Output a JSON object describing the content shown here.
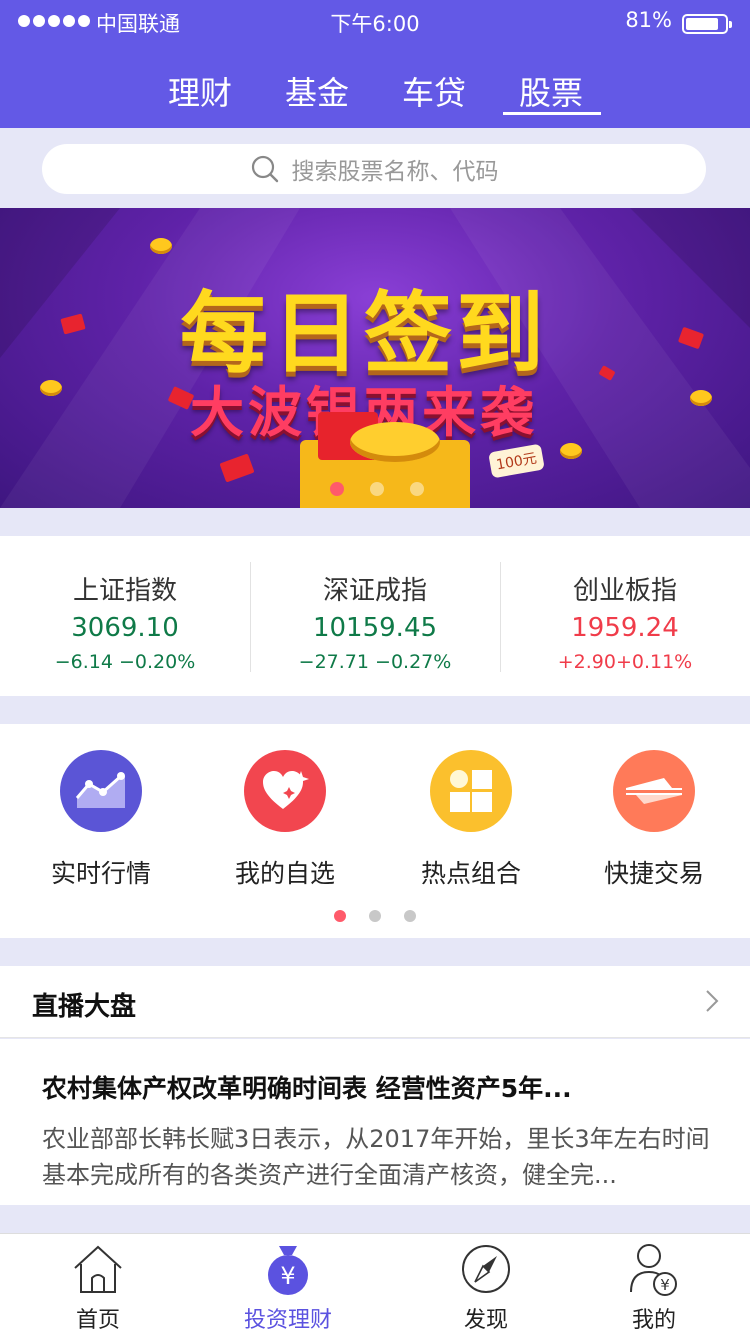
{
  "status_bar": {
    "carrier": "中国联通",
    "time": "下午6:00",
    "battery": "81%"
  },
  "tabs": [
    {
      "label": "理财"
    },
    {
      "label": "基金"
    },
    {
      "label": "车贷"
    },
    {
      "label": "股票",
      "active": true
    }
  ],
  "search": {
    "placeholder": "搜索股票名称、代码"
  },
  "banner": {
    "title": "每日签到",
    "subtitle": "大波银两来袭",
    "badge": "100元"
  },
  "indices": [
    {
      "name": "上证指数",
      "value": "3069.10",
      "change": "−6.14 −0.20%",
      "trend": "down"
    },
    {
      "name": "深证成指",
      "value": "10159.45",
      "change": "−27.71 −0.27%",
      "trend": "down"
    },
    {
      "name": "创业板指",
      "value": "1959.24",
      "change": "+2.90+0.11%",
      "trend": "up"
    }
  ],
  "shortcuts": [
    {
      "label": "实时行情",
      "icon": "line-chart-icon",
      "color": "#5b55d6"
    },
    {
      "label": "我的自选",
      "icon": "heart-icon",
      "color": "#f2464f"
    },
    {
      "label": "热点组合",
      "icon": "grid-icon",
      "color": "#fbc02d"
    },
    {
      "label": "快捷交易",
      "icon": "transfer-icon",
      "color": "#ff7a59"
    }
  ],
  "live": {
    "title": "直播大盘",
    "article": {
      "headline": "农村集体产权改革明确时间表 经营性资产5年...",
      "body": "农业部部长韩长赋3日表示，从2017年开始，里长3年左右时间基本完成所有的各类资产进行全面清产核资，健全完..."
    }
  },
  "tabbar": [
    {
      "label": "首页",
      "icon": "home-icon"
    },
    {
      "label": "投资理财",
      "icon": "yuan-bag-icon",
      "active": true
    },
    {
      "label": "发现",
      "icon": "compass-icon"
    },
    {
      "label": "我的",
      "icon": "user-yuan-icon"
    }
  ],
  "colors": {
    "brand": "#6359e6",
    "down": "#0f7a48",
    "up": "#f03c4a",
    "accent_dot": "#ff5a6a"
  }
}
